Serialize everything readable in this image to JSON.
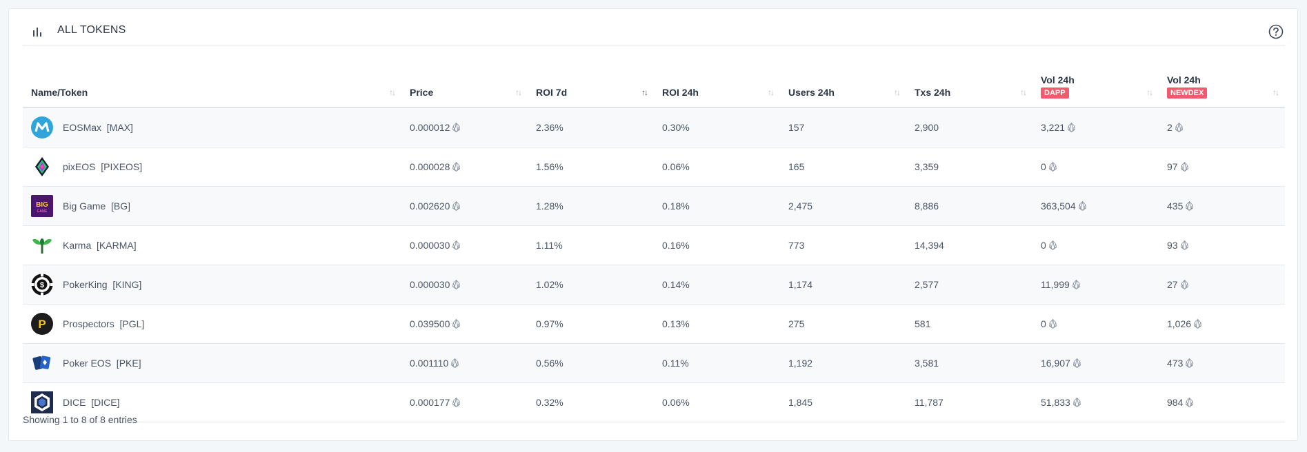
{
  "header": {
    "title": "ALL TOKENS"
  },
  "columns": [
    {
      "label": "Name/Token",
      "badge": ""
    },
    {
      "label": "Price",
      "badge": ""
    },
    {
      "label": "ROI 7d",
      "badge": ""
    },
    {
      "label": "ROI 24h",
      "badge": ""
    },
    {
      "label": "Users 24h",
      "badge": ""
    },
    {
      "label": "Txs 24h",
      "badge": ""
    },
    {
      "label": "Vol 24h",
      "badge": "DAPP"
    },
    {
      "label": "Vol 24h",
      "badge": "NEWDEX"
    }
  ],
  "sort_icons": {
    "inactive": "↑↓",
    "active": "↑↓"
  },
  "rows": [
    {
      "name": "EOSMax  [MAX]",
      "logo": "eosmax-logo",
      "price": "0.000012",
      "roi7d": "2.36%",
      "roi24h": "0.30%",
      "users": "157",
      "txs": "2,900",
      "vol_dapp": "3,221",
      "vol_newdex": "2"
    },
    {
      "name": "pixEOS  [PIXEOS]",
      "logo": "pixeos-logo",
      "price": "0.000028",
      "roi7d": "1.56%",
      "roi24h": "0.06%",
      "users": "165",
      "txs": "3,359",
      "vol_dapp": "0",
      "vol_newdex": "97"
    },
    {
      "name": "Big Game  [BG]",
      "logo": "biggame-logo",
      "price": "0.002620",
      "roi7d": "1.28%",
      "roi24h": "0.18%",
      "users": "2,475",
      "txs": "8,886",
      "vol_dapp": "363,504",
      "vol_newdex": "435"
    },
    {
      "name": "Karma  [KARMA]",
      "logo": "karma-logo",
      "price": "0.000030",
      "roi7d": "1.11%",
      "roi24h": "0.16%",
      "users": "773",
      "txs": "14,394",
      "vol_dapp": "0",
      "vol_newdex": "93"
    },
    {
      "name": "PokerKing  [KING]",
      "logo": "pokerking-logo",
      "price": "0.000030",
      "roi7d": "1.02%",
      "roi24h": "0.14%",
      "users": "1,174",
      "txs": "2,577",
      "vol_dapp": "11,999",
      "vol_newdex": "27"
    },
    {
      "name": "Prospectors  [PGL]",
      "logo": "prospectors-logo",
      "price": "0.039500",
      "roi7d": "0.97%",
      "roi24h": "0.13%",
      "users": "275",
      "txs": "581",
      "vol_dapp": "0",
      "vol_newdex": "1,026"
    },
    {
      "name": "Poker EOS  [PKE]",
      "logo": "pokereos-logo",
      "price": "0.001110",
      "roi7d": "0.56%",
      "roi24h": "0.11%",
      "users": "1,192",
      "txs": "3,581",
      "vol_dapp": "16,907",
      "vol_newdex": "473"
    },
    {
      "name": "DICE  [DICE]",
      "logo": "dice-logo",
      "price": "0.000177",
      "roi7d": "0.32%",
      "roi24h": "0.06%",
      "users": "1,845",
      "txs": "11,787",
      "vol_dapp": "51,833",
      "vol_newdex": "984"
    }
  ],
  "footer": {
    "info": "Showing 1 to 8 of 8 entries"
  },
  "colors": {
    "accent_badge": "#f25a6d",
    "header_text": "#2b3644",
    "cell_text": "#4a5666"
  }
}
